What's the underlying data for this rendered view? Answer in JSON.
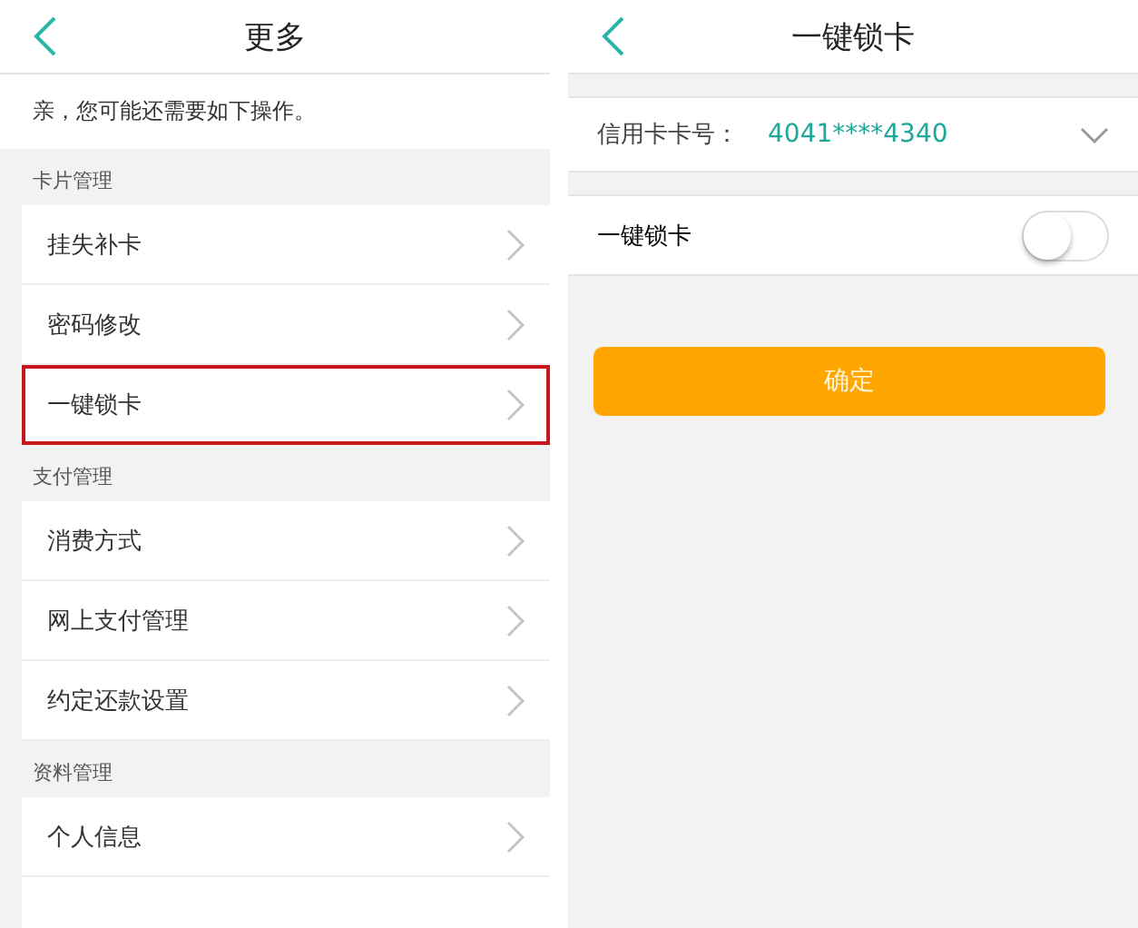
{
  "left_screen": {
    "title": "更多",
    "notice": "亲，您可能还需要如下操作。",
    "sections": [
      {
        "label": "卡片管理",
        "items": [
          {
            "label": "挂失补卡",
            "highlighted": false
          },
          {
            "label": "密码修改",
            "highlighted": false
          },
          {
            "label": "一键锁卡",
            "highlighted": true
          }
        ]
      },
      {
        "label": "支付管理",
        "items": [
          {
            "label": "消费方式",
            "highlighted": false
          },
          {
            "label": "网上支付管理",
            "highlighted": false
          },
          {
            "label": "约定还款设置",
            "highlighted": false
          }
        ]
      },
      {
        "label": "资料管理",
        "items": [
          {
            "label": "个人信息",
            "highlighted": false
          }
        ]
      }
    ]
  },
  "right_screen": {
    "title": "一键锁卡",
    "card_field": {
      "label": "信用卡卡号：",
      "value": "4041****4340"
    },
    "lock_toggle": {
      "label": "一键锁卡",
      "on": false
    },
    "confirm_button": "确定"
  }
}
